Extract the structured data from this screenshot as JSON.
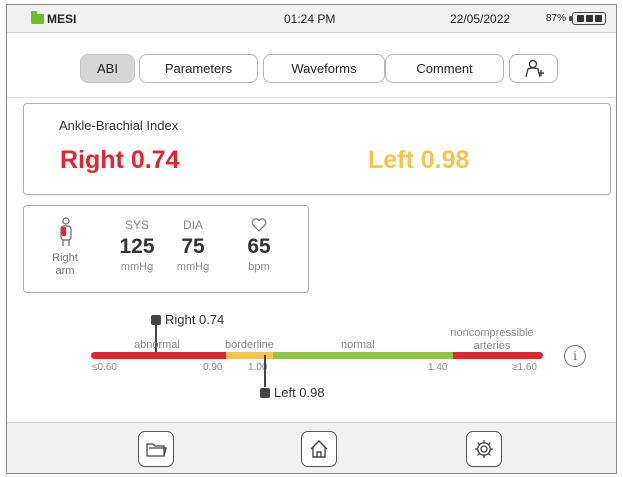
{
  "status": {
    "brand": "MESI",
    "time": "01:24 PM",
    "date": "22/05/2022",
    "battery": "87%"
  },
  "tabs": [
    {
      "label": "ABI",
      "active": true
    },
    {
      "label": "Parameters",
      "active": false
    },
    {
      "label": "Waveforms",
      "active": false
    },
    {
      "label": "Comment",
      "active": false
    },
    {
      "label": "",
      "icon": "add-user-icon",
      "active": false
    }
  ],
  "abi": {
    "title": "Ankle-Brachial Index",
    "right_text": "Right 0.74",
    "left_text": "Left 0.98",
    "right_color": "#e0262f",
    "left_color": "#f7c44a"
  },
  "measurement": {
    "location": "Right arm",
    "sys": {
      "label": "SYS",
      "value": "125",
      "unit": "mmHg"
    },
    "dia": {
      "label": "DIA",
      "value": "75",
      "unit": "mmHg"
    },
    "hr": {
      "icon": "heart-icon",
      "value": "65",
      "unit": "bpm"
    }
  },
  "scale": {
    "right_marker": "Right 0.74",
    "left_marker": "Left 0.98",
    "zones": {
      "abnormal": "abnormal",
      "borderline": "borderline",
      "normal": "normal",
      "noncompressible": "noncompressible arteries"
    },
    "ticks": [
      "≤0.60",
      "0.90",
      "1.00",
      "1.40",
      "≥1.60"
    ],
    "colors": {
      "abnormal": "#e0262f",
      "borderline": "#f7c44a",
      "normal": "#8dc63f",
      "noncompressible": "#e0262f"
    },
    "info_label": "i"
  },
  "nav": [
    {
      "icon": "folder-icon"
    },
    {
      "icon": "home-icon"
    },
    {
      "icon": "settings-gear-icon"
    }
  ]
}
